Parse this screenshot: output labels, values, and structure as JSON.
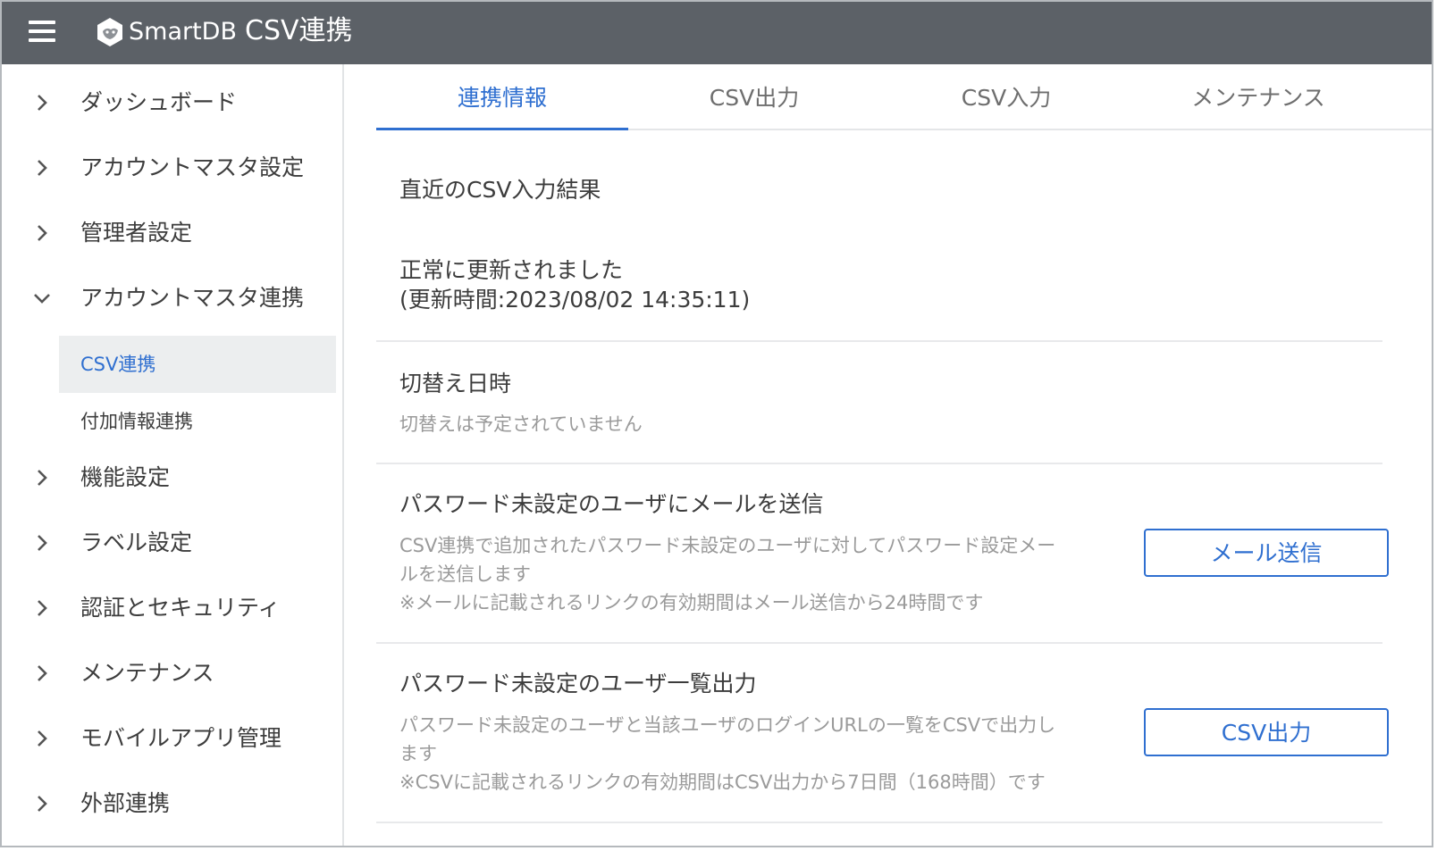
{
  "header": {
    "brand": "SmartDB",
    "title": "CSV連携"
  },
  "sidebar": {
    "items": [
      {
        "label": "ダッシュボード",
        "expanded": false
      },
      {
        "label": "アカウントマスタ設定",
        "expanded": false
      },
      {
        "label": "管理者設定",
        "expanded": false
      },
      {
        "label": "アカウントマスタ連携",
        "expanded": true
      },
      {
        "label": "機能設定",
        "expanded": false
      },
      {
        "label": "ラベル設定",
        "expanded": false
      },
      {
        "label": "認証とセキュリティ",
        "expanded": false
      },
      {
        "label": "メンテナンス",
        "expanded": false
      },
      {
        "label": "モバイルアプリ管理",
        "expanded": false
      },
      {
        "label": "外部連携",
        "expanded": false
      }
    ],
    "subitems": [
      {
        "label": "CSV連携",
        "active": true
      },
      {
        "label": "付加情報連携",
        "active": false
      }
    ]
  },
  "tabs": [
    {
      "label": "連携情報",
      "active": true
    },
    {
      "label": "CSV出力",
      "active": false
    },
    {
      "label": "CSV入力",
      "active": false
    },
    {
      "label": "メンテナンス",
      "active": false
    }
  ],
  "sections": {
    "latest": {
      "title": "直近のCSV入力結果",
      "status": "正常に更新されました",
      "updated": "(更新時間:2023/08/02 14:35:11)"
    },
    "switch": {
      "title": "切替え日時",
      "text": "切替えは予定されていません"
    },
    "mail": {
      "title": "パスワード未設定のユーザにメールを送信",
      "line1": "CSV連携で追加されたパスワード未設定のユーザに対してパスワード設定メー",
      "line2": "ルを送信します",
      "line3": "※メールに記載されるリンクの有効期間はメール送信から24時間です",
      "button": "メール送信"
    },
    "export": {
      "title": "パスワード未設定のユーザ一覧出力",
      "line1": "パスワード未設定のユーザと当該ユーザのログインURLの一覧をCSVで出力し",
      "line2": "ます",
      "line3": "※CSVに記載されるリンクの有効期間はCSV出力から7日間（168時間）です",
      "button": "CSV出力"
    }
  },
  "colors": {
    "header_bg": "#5c6167",
    "accent": "#2f6fd0",
    "active_bg": "#eceeef",
    "muted_text": "#9a9a9a"
  },
  "icons": {
    "menu": "hamburger-icon",
    "logo": "smartdb-logo-icon",
    "collapsed": "chevron-right-icon",
    "expanded": "chevron-down-icon"
  }
}
